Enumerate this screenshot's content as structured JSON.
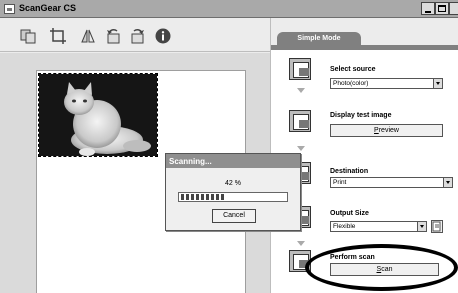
{
  "window": {
    "title": "ScanGear CS"
  },
  "toolbar": {
    "buttons": [
      {
        "name": "thumbnail-icon"
      },
      {
        "name": "crop-icon"
      },
      {
        "name": "mirror-icon"
      },
      {
        "name": "rotate-left-icon"
      },
      {
        "name": "rotate-right-icon"
      },
      {
        "name": "info-icon"
      }
    ]
  },
  "panel": {
    "tab_label": "Simple Mode",
    "select_source": {
      "label": "Select source",
      "value": "Photo(color)"
    },
    "display_test_image": {
      "label": "Display test image",
      "button_label": "Preview",
      "button_underline": "P",
      "button_rest": "review"
    },
    "destination": {
      "label": "Destination",
      "value": "Print"
    },
    "output_size": {
      "label": "Output Size",
      "value": "Flexible"
    },
    "perform_scan": {
      "label": "Perform scan",
      "button_label": "Scan",
      "button_underline": "S",
      "button_rest": "can"
    }
  },
  "dialog": {
    "title": "Scanning...",
    "percent_text": "42 %",
    "progress": 0.42,
    "cancel_label": "Cancel"
  },
  "colors": {
    "titlebar": "#a9a9a9",
    "tab": "#808080",
    "highlight_ellipse": "#000000"
  }
}
